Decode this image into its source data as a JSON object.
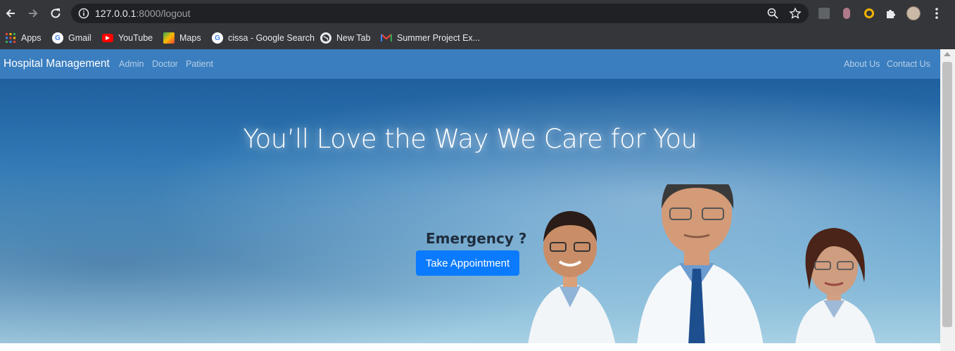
{
  "browser": {
    "url_host": "127.0.0.1",
    "url_rest": ":8000/logout",
    "bookmarks": [
      {
        "label": "Apps",
        "icon": "apps-grid-icon"
      },
      {
        "label": "Gmail",
        "icon": "google-icon"
      },
      {
        "label": "YouTube",
        "icon": "youtube-icon"
      },
      {
        "label": "Maps",
        "icon": "maps-icon"
      },
      {
        "label": "cissa - Google Search",
        "icon": "google-icon"
      },
      {
        "label": "New Tab",
        "icon": "globe-icon"
      },
      {
        "label": "Summer Project Ex...",
        "icon": "gmail-icon"
      }
    ]
  },
  "navbar": {
    "brand": "Hospital Management",
    "links_left": [
      "Admin",
      "Doctor",
      "Patient"
    ],
    "links_right": [
      "About Us",
      "Contact Us"
    ]
  },
  "hero": {
    "title": "You’ll Love the Way We Care for You",
    "emergency": "Emergency ?",
    "button": "Take Appointment"
  },
  "colors": {
    "navbar": "#3a7ebf",
    "button": "#0a7bff",
    "chrome": "#35363a"
  }
}
